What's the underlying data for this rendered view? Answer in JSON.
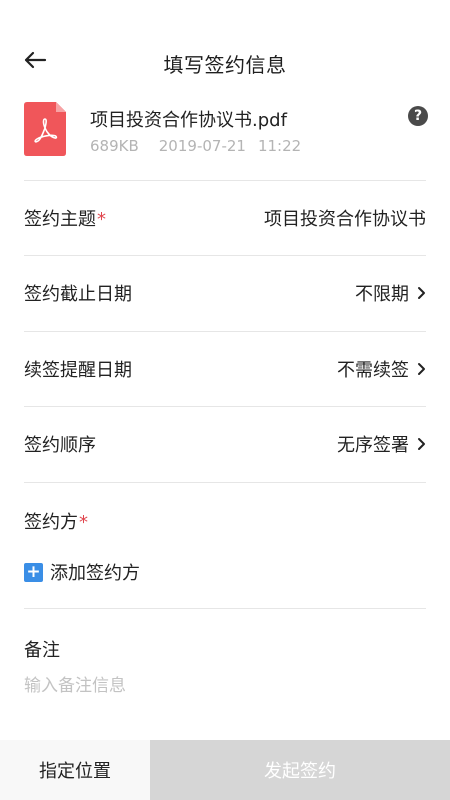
{
  "header": {
    "title": "填写签约信息",
    "back_icon": "arrow-left-icon"
  },
  "file": {
    "name": "项目投资合作协议书.pdf",
    "size": "689KB",
    "date": "2019-07-21",
    "time": "11:22",
    "icon": "pdf-file-icon",
    "icon_color": "#f0565a",
    "help_icon": "question-mark-icon",
    "help_glyph": "?"
  },
  "form": {
    "subject": {
      "label": "签约主题",
      "required_mark": "*",
      "value": "项目投资合作协议书"
    },
    "deadline": {
      "label": "签约截止日期",
      "value": "不限期"
    },
    "reminder": {
      "label": "续签提醒日期",
      "value": "不需续签"
    },
    "order": {
      "label": "签约顺序",
      "value": "无序签署"
    },
    "signers": {
      "label": "签约方",
      "required_mark": "*",
      "add_label": "添加签约方",
      "add_icon": "plus-icon"
    },
    "note": {
      "label": "备注",
      "placeholder": "输入备注信息",
      "value": ""
    }
  },
  "footer": {
    "position_label": "指定位置",
    "start_label": "发起签约"
  },
  "colors": {
    "required": "#e0454d",
    "accent": "#3a8ee6",
    "disabled_button": "#d6d6d6",
    "pdf_red": "#f0565a"
  }
}
